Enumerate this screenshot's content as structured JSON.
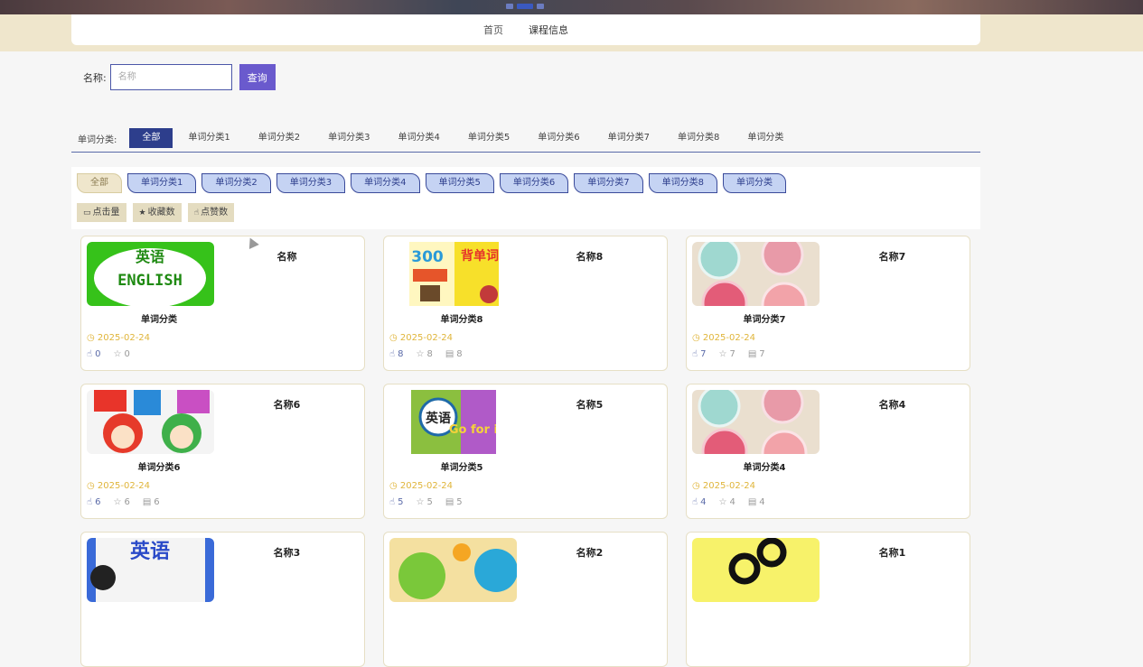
{
  "nav": {
    "home": "首页",
    "courses": "课程信息"
  },
  "search": {
    "label": "名称:",
    "placeholder": "名称",
    "button": "查询"
  },
  "tabs": {
    "label": "单词分类:",
    "items": [
      "全部",
      "单词分类1",
      "单词分类2",
      "单词分类3",
      "单词分类4",
      "单词分类5",
      "单词分类6",
      "单词分类7",
      "单词分类8",
      "单词分类"
    ],
    "active_index": 0
  },
  "chips": [
    "全部",
    "单词分类1",
    "单词分类2",
    "单词分类3",
    "单词分类4",
    "单词分类5",
    "单词分类6",
    "单词分类7",
    "单词分类8",
    "单词分类"
  ],
  "sorts": [
    {
      "icon": "eye-icon",
      "label": "点击量"
    },
    {
      "icon": "star-icon",
      "label": "收藏数"
    },
    {
      "icon": "thumb-icon",
      "label": "点赞数"
    }
  ],
  "cards": [
    {
      "name": "名称",
      "category": "单词分类",
      "date": "2025-02-24",
      "likes": "0",
      "stars": "0",
      "views": "",
      "thumb": "english-image"
    },
    {
      "name": "名称8",
      "category": "单词分类8",
      "date": "2025-02-24",
      "likes": "8",
      "stars": "8",
      "views": "8",
      "thumb": "book-image"
    },
    {
      "name": "名称7",
      "category": "单词分类7",
      "date": "2025-02-24",
      "likes": "7",
      "stars": "7",
      "views": "7",
      "thumb": "abcd-cookie-image"
    },
    {
      "name": "名称6",
      "category": "单词分类6",
      "date": "2025-02-24",
      "likes": "6",
      "stars": "6",
      "views": "6",
      "thumb": "abc-kids-image"
    },
    {
      "name": "名称5",
      "category": "单词分类5",
      "date": "2025-02-24",
      "likes": "5",
      "stars": "5",
      "views": "5",
      "thumb": "english-go-image"
    },
    {
      "name": "名称4",
      "category": "单词分类4",
      "date": "2025-02-24",
      "likes": "4",
      "stars": "4",
      "views": "4",
      "thumb": "abcd-cookie-image"
    },
    {
      "name": "名称3",
      "category": "",
      "date": "",
      "likes": "",
      "stars": "",
      "views": "",
      "thumb": "english-words-image"
    },
    {
      "name": "名称2",
      "category": "",
      "date": "",
      "likes": "",
      "stars": "",
      "views": "",
      "thumb": "abc-colorful-image"
    },
    {
      "name": "名称1",
      "category": "",
      "date": "",
      "likes": "",
      "stars": "",
      "views": "",
      "thumb": "yellow-circles-image"
    }
  ],
  "thumb_text": {
    "english_top": "英语",
    "english_bottom": "ENGLISH",
    "book_300": "300",
    "book_side": "背单词",
    "go_badge": "英语",
    "go_text": "Go for it",
    "words_text": "英语"
  },
  "colors": {
    "accent": "#2d3e8c",
    "button": "#6a5acd",
    "date": "#e0b53a",
    "chip_bg": "#c5d3f3",
    "band": "#efe6cc"
  }
}
